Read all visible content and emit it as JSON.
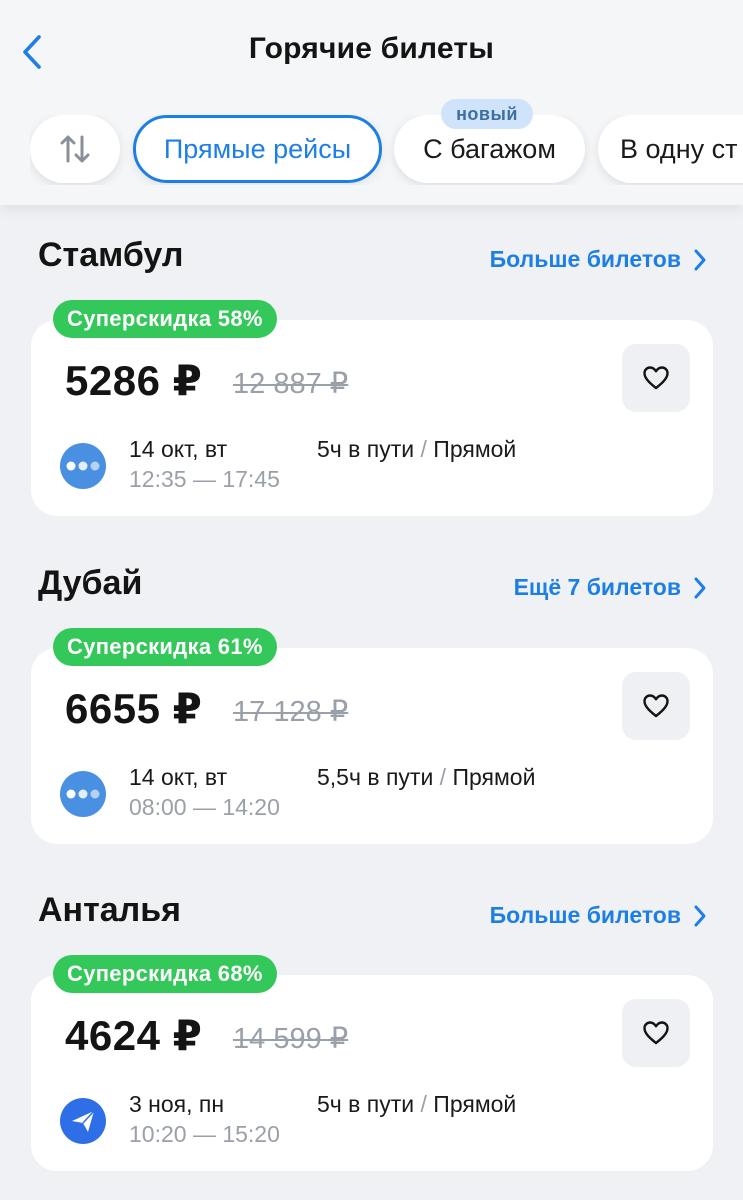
{
  "header": {
    "title": "Горячие билеты",
    "chips": {
      "direct": "Прямые рейсы",
      "baggage": "С багажом",
      "oneway": "В одну ст",
      "new_badge": "новый"
    }
  },
  "colors": {
    "accent": "#1d7fe6",
    "discount_green": "#34c759",
    "background": "#eff1f5",
    "muted": "#9aa0a8"
  },
  "sections": [
    {
      "city": "Стамбул",
      "more_link": "Больше билетов",
      "discount": "Суперскидка 58%",
      "price": "5286 ₽",
      "old_price": "12 887 ₽",
      "date": "14 окт, вт",
      "times": "12:35 — 17:45",
      "duration": "5ч в пути",
      "separator": " / ",
      "flight_type": "Прямой",
      "airline_icon": "airline-dots-icon"
    },
    {
      "city": "Дубай",
      "more_link": "Ещё 7 билетов",
      "discount": "Суперскидка 61%",
      "price": "6655 ₽",
      "old_price": "17 128 ₽",
      "date": "14 окт, вт",
      "times": "08:00 — 14:20",
      "duration": "5,5ч в пути",
      "separator": " / ",
      "flight_type": "Прямой",
      "airline_icon": "airline-dots-icon"
    },
    {
      "city": "Анталья",
      "more_link": "Больше билетов",
      "discount": "Суперскидка 68%",
      "price": "4624 ₽",
      "old_price": "14 599 ₽",
      "date": "3 ноя, пн",
      "times": "10:20 — 15:20",
      "duration": "5ч в пути",
      "separator": " / ",
      "flight_type": "Прямой",
      "airline_icon": "airline-plane-icon"
    }
  ]
}
